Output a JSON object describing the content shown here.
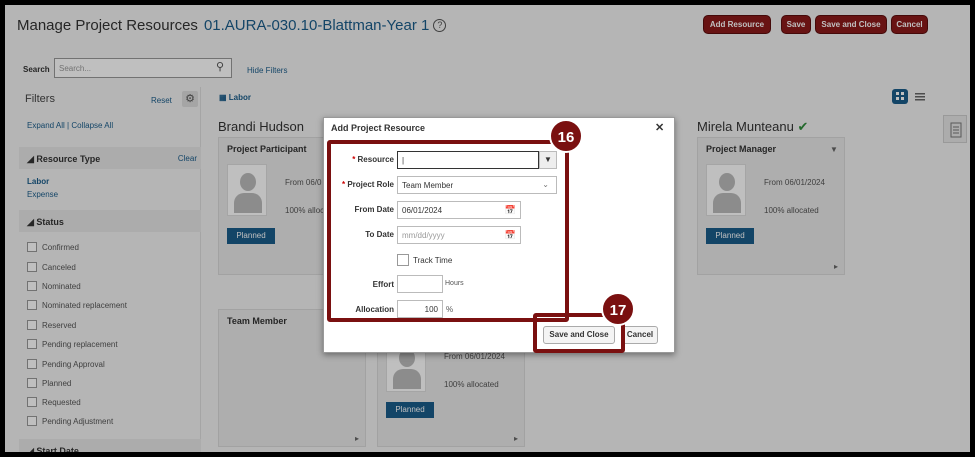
{
  "header": {
    "title": "Manage Project Resources",
    "project": "01.AURA-030.10-Blattman-Year 1",
    "buttons": {
      "add_resource": "Add Resource",
      "save": "Save",
      "save_close": "Save and Close",
      "cancel": "Cancel"
    }
  },
  "search": {
    "label": "Search",
    "placeholder": "Search...",
    "hide_filters": "Hide Filters"
  },
  "filters": {
    "title": "Filters",
    "reset": "Reset",
    "expand_all": "Expand All",
    "collapse_all": "Collapse All",
    "resource_type": {
      "label": "Resource Type",
      "clear": "Clear",
      "items": [
        "Labor",
        "Expense"
      ]
    },
    "status": {
      "label": "Status",
      "items": [
        "Confirmed",
        "Canceled",
        "Nominated",
        "Nominated replacement",
        "Reserved",
        "Pending replacement",
        "Pending Approval",
        "Planned",
        "Requested",
        "Pending Adjustment"
      ]
    },
    "start_date": {
      "label": "Start Date"
    }
  },
  "content": {
    "labor_tag": "Labor",
    "cards": [
      {
        "name": "Brandi Hudson",
        "role": "Project Participant",
        "from": "From 06/0",
        "alloc": "100% alloca",
        "status": "Planned"
      },
      {
        "name": "Mirela Munteanu",
        "role": "Project Manager",
        "from": "From 06/01/2024",
        "alloc": "100% allocated",
        "status": "Planned"
      },
      {
        "role": "Team Member"
      },
      {
        "from": "From 06/01/2024",
        "alloc": "100% allocated",
        "status": "Planned"
      }
    ]
  },
  "dialog": {
    "title": "Add Project Resource",
    "fields": {
      "resource": {
        "label": "Resource",
        "value": "|"
      },
      "project_role": {
        "label": "Project Role",
        "value": "Team Member"
      },
      "from_date": {
        "label": "From Date",
        "value": "06/01/2024"
      },
      "to_date": {
        "label": "To Date",
        "placeholder": "mm/dd/yyyy"
      },
      "track_time": {
        "label": "Track Time"
      },
      "effort": {
        "label": "Effort",
        "unit": "Hours",
        "value": ""
      },
      "allocation": {
        "label": "Allocation",
        "value": "100",
        "unit": "%"
      }
    },
    "buttons": {
      "save_close": "Save and Close",
      "cancel": "Cancel"
    }
  },
  "callouts": {
    "step1": "16",
    "step2": "17"
  },
  "colors": {
    "accent": "#8b1a1a",
    "link": "#1a5c8a",
    "callout": "#7a1010"
  }
}
